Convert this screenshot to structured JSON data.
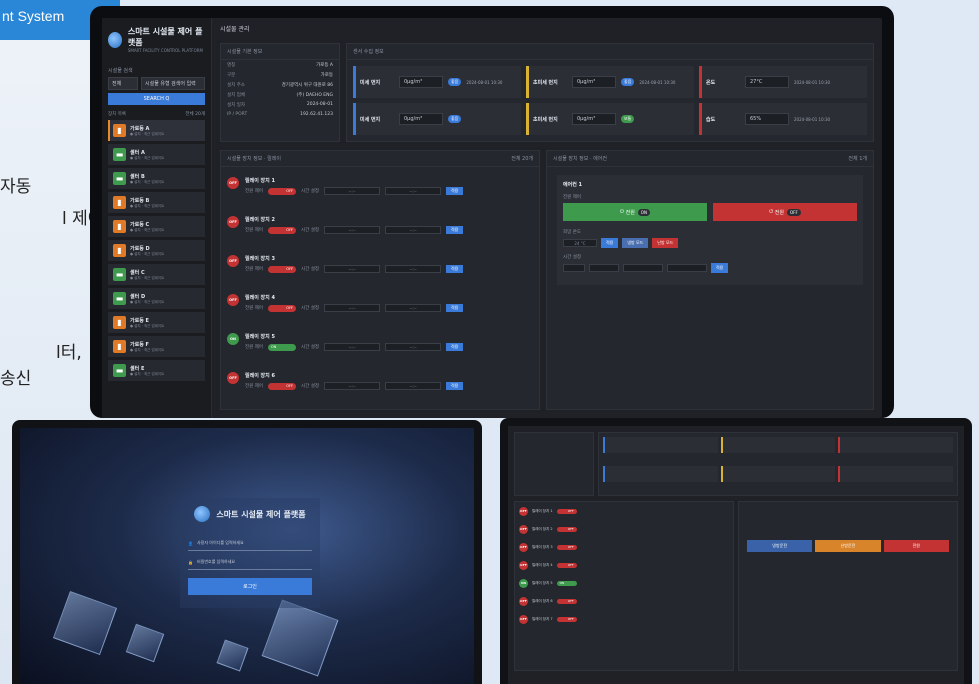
{
  "promo": {
    "tag": "nt System",
    "lines": [
      "자동",
      "l 제어,",
      "l터,",
      "송신"
    ]
  },
  "app": {
    "title": "스마트 시설물 제어 플랫폼",
    "subtitle": "SMART FACILITY CONTROL PLATFORM",
    "page_title": "시설물 관리"
  },
  "sidebar": {
    "filter_label": "시설물 검색",
    "filter_type": "전체",
    "filter_placeholder": "시설물 유형 검색어 입력",
    "search_button": "SEARCH Q",
    "list_label": "장치 목록",
    "list_count": "전체 20개",
    "items": [
      {
        "name": "가로등 A",
        "sub": "● 설치 · 최근 업데이트",
        "type": "orange",
        "icon": "lamp-icon"
      },
      {
        "name": "셸터 A",
        "sub": "● 설치 · 최근 업데이트",
        "type": "green",
        "icon": "bus-shelter-icon"
      },
      {
        "name": "셸터 B",
        "sub": "● 설치 · 최근 업데이트",
        "type": "green",
        "icon": "bus-shelter-icon"
      },
      {
        "name": "가로등 B",
        "sub": "● 설치 · 최근 업데이트",
        "type": "orange",
        "icon": "lamp-icon"
      },
      {
        "name": "가로등 C",
        "sub": "● 설치 · 최근 업데이트",
        "type": "orange",
        "icon": "lamp-icon"
      },
      {
        "name": "가로등 D",
        "sub": "● 설치 · 최근 업데이트",
        "type": "orange",
        "icon": "lamp-icon"
      },
      {
        "name": "셸터 C",
        "sub": "● 설치 · 최근 업데이트",
        "type": "green",
        "icon": "bus-shelter-icon"
      },
      {
        "name": "셸터 D",
        "sub": "● 설치 · 최근 업데이트",
        "type": "green",
        "icon": "bus-shelter-icon"
      },
      {
        "name": "가로등 E",
        "sub": "● 설치 · 최근 업데이트",
        "type": "orange",
        "icon": "lamp-icon"
      },
      {
        "name": "가로등 F",
        "sub": "● 설치 · 최근 업데이트",
        "type": "orange",
        "icon": "lamp-icon"
      },
      {
        "name": "셸터 E",
        "sub": "● 설치 · 최근 업데이트",
        "type": "green",
        "icon": "bus-shelter-icon"
      }
    ]
  },
  "basic_info": {
    "title": "시설물 기본 정보",
    "rows": [
      {
        "k": "명칭",
        "v": "가로등 A"
      },
      {
        "k": "구분",
        "v": "가로등"
      },
      {
        "k": "설치 주소",
        "v": "경기광역시 위구 대원로 86"
      },
      {
        "k": "설치 업체",
        "v": "(주) DAEHO ENG"
      },
      {
        "k": "설치 일자",
        "v": "2024-08-01"
      },
      {
        "k": "IP / PORT",
        "v": "192.62.41.123"
      }
    ]
  },
  "sensors": {
    "title": "센서 수집 정보",
    "cards": [
      {
        "name": "미세 먼지",
        "unit": "0μg/m³",
        "badge": "좋음",
        "badge_color": "#3a7ad8",
        "time": "2024-08-01 10:30",
        "color": "#3a7ad8"
      },
      {
        "name": "초미세 먼지",
        "unit": "0μg/m³",
        "badge": "좋음",
        "badge_color": "#3a7ad8",
        "time": "2024-08-01 10:30",
        "color": "#d8b233"
      },
      {
        "name": "온도",
        "unit": "27°C",
        "badge": "",
        "badge_color": "",
        "time": "2024-08-01 10:30",
        "color": "#c43333"
      },
      {
        "name": "미세 먼지",
        "unit": "0μg/m³",
        "badge": "좋음",
        "badge_color": "#3a7ad8",
        "time": "",
        "color": "#3a7ad8"
      },
      {
        "name": "초미세 먼지",
        "unit": "0μg/m³",
        "badge": "보통",
        "badge_color": "#3e9a4c",
        "time": "",
        "color": "#d8b233"
      },
      {
        "name": "습도",
        "unit": "65%",
        "badge": "",
        "badge_color": "",
        "time": "2024-08-01 10:30",
        "color": "#c43333"
      }
    ]
  },
  "controls": {
    "title": "시설물 장치 정보 · 릴레이",
    "count": "전체 20개",
    "items": [
      {
        "name": "릴레이 장치 1",
        "state": "OFF",
        "on": false
      },
      {
        "name": "릴레이 장치 2",
        "state": "OFF",
        "on": false
      },
      {
        "name": "릴레이 장치 3",
        "state": "OFF",
        "on": false
      },
      {
        "name": "릴레이 장치 4",
        "state": "OFF",
        "on": false
      },
      {
        "name": "릴레이 장치 5",
        "state": "ON",
        "on": true
      },
      {
        "name": "릴레이 장치 6",
        "state": "OFF",
        "on": false
      },
      {
        "name": "릴레이 장치 7",
        "state": "OFF",
        "on": false
      }
    ],
    "power_label": "전원 제어",
    "time_label": "시간 설정",
    "time_placeholder": "--:--",
    "apply": "적용"
  },
  "detail": {
    "title": "시설물 장치 정보 · 에어컨",
    "count": "전체 1개",
    "device": "에어컨 1",
    "power_label": "전원 제어",
    "on_btn": "전원",
    "on_chip": "ON",
    "off_btn": "전원",
    "off_chip": "OFF",
    "temp_label": "희망 온도",
    "temp_value": "24 °C",
    "btn_apply": "적용",
    "btn_cool": "냉방 모드",
    "btn_heat": "난방 모드",
    "schedule_label": "시간 설정",
    "schedule_apply": "적용"
  },
  "login": {
    "app_title": "스마트 시설물 제어 플랫폼",
    "id_placeholder": "사용자 아이디를 입력하세요",
    "pw_placeholder": "비밀번호를 입력하세요",
    "button": "로그인"
  },
  "right_screen": {
    "btns": [
      "냉방운전",
      "난방운전",
      "전원"
    ]
  }
}
